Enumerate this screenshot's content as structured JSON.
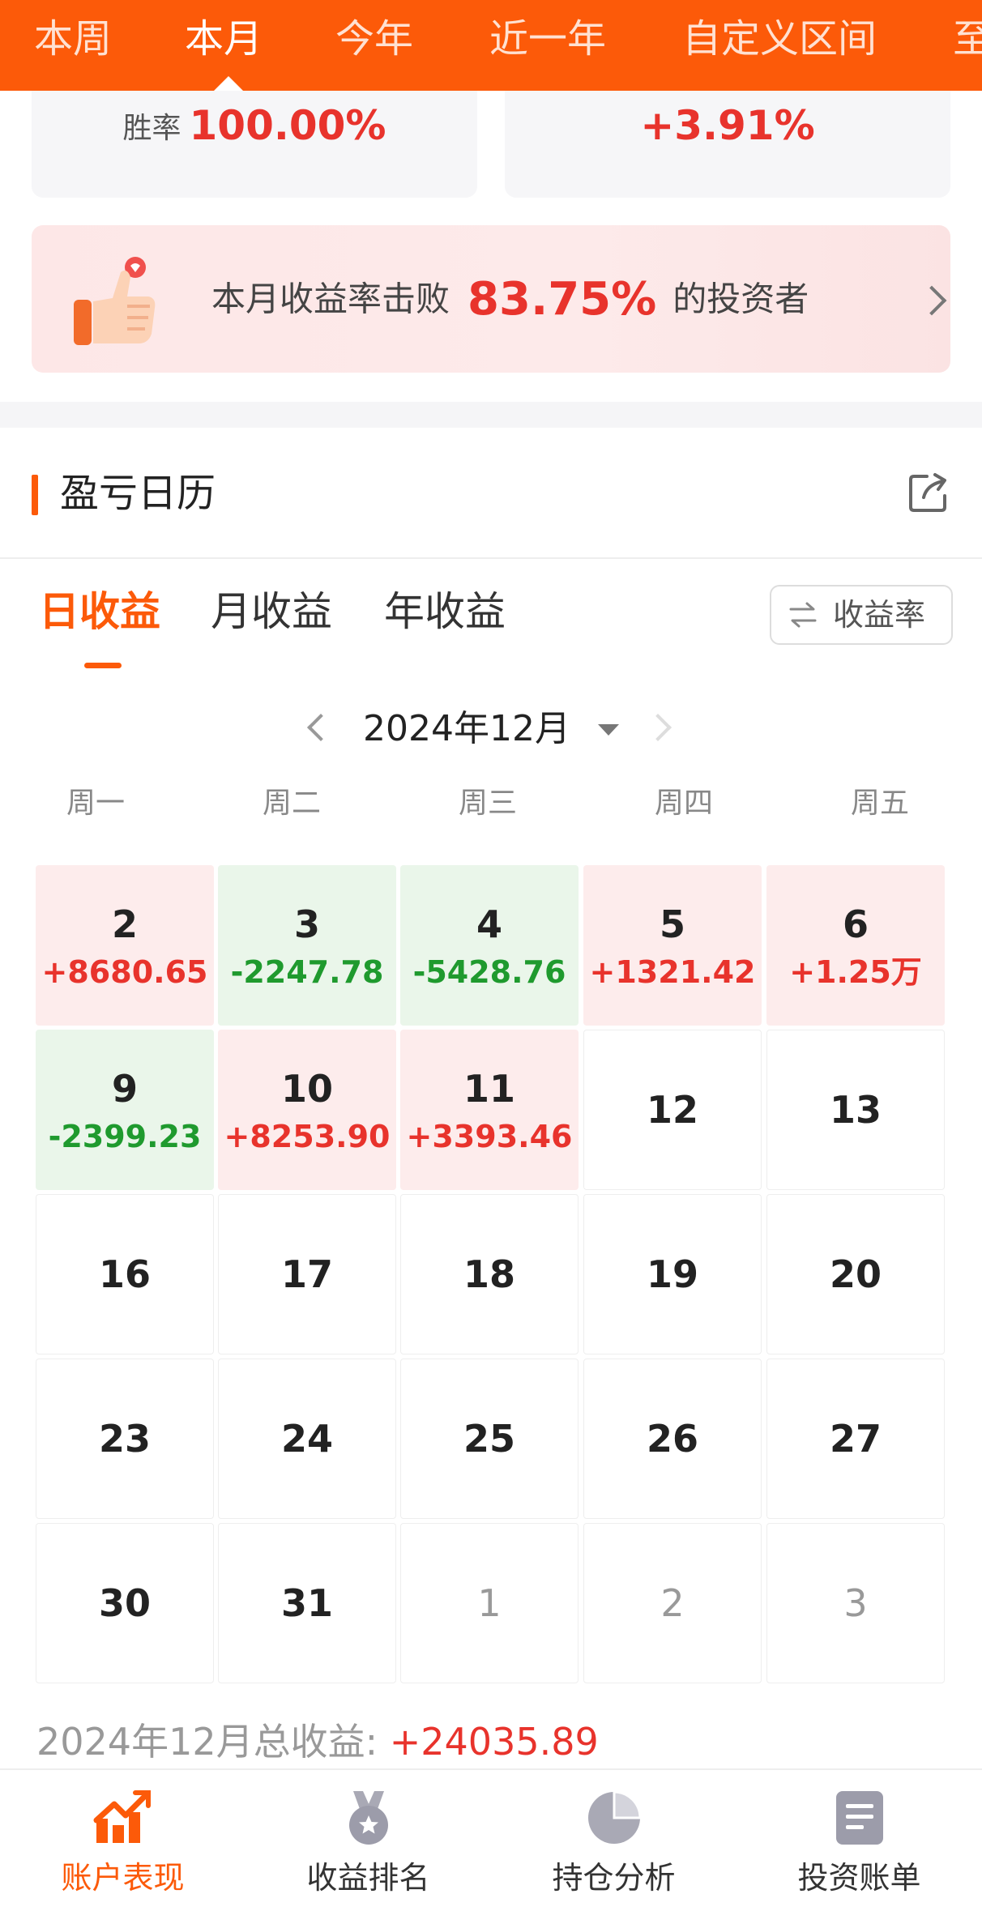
{
  "period_tabs": [
    {
      "label": "本周",
      "active": false
    },
    {
      "label": "本月",
      "active": true
    },
    {
      "label": "今年",
      "active": false
    },
    {
      "label": "近一年",
      "active": false
    },
    {
      "label": "自定义区间",
      "active": false
    },
    {
      "label": "至",
      "active": false
    }
  ],
  "summary": {
    "win_rate_label": "胜率",
    "win_rate_value": "100.00%",
    "return_value": "+3.91%"
  },
  "beat_banner": {
    "prefix": "本月收益率击败",
    "percent": "83.75%",
    "suffix": "的投资者"
  },
  "calendar": {
    "title": "盈亏日历",
    "tabs": [
      "日收益",
      "月收益",
      "年收益"
    ],
    "active_tab": "日收益",
    "rate_toggle_label": "收益率",
    "month_label": "2024年12月",
    "weekdays": [
      "周一",
      "周二",
      "周三",
      "周四",
      "周五"
    ],
    "days": [
      {
        "day": "2",
        "pl": "+8680.65",
        "type": "pos"
      },
      {
        "day": "3",
        "pl": "-2247.78",
        "type": "neg"
      },
      {
        "day": "4",
        "pl": "-5428.76",
        "type": "neg"
      },
      {
        "day": "5",
        "pl": "+1321.42",
        "type": "pos"
      },
      {
        "day": "6",
        "pl": "+1.25万",
        "type": "pos"
      },
      {
        "day": "9",
        "pl": "-2399.23",
        "type": "neg"
      },
      {
        "day": "10",
        "pl": "+8253.90",
        "type": "pos"
      },
      {
        "day": "11",
        "pl": "+3393.46",
        "type": "pos"
      },
      {
        "day": "12",
        "pl": "",
        "type": "none"
      },
      {
        "day": "13",
        "pl": "",
        "type": "none"
      },
      {
        "day": "16",
        "pl": "",
        "type": "none"
      },
      {
        "day": "17",
        "pl": "",
        "type": "none"
      },
      {
        "day": "18",
        "pl": "",
        "type": "none"
      },
      {
        "day": "19",
        "pl": "",
        "type": "none"
      },
      {
        "day": "20",
        "pl": "",
        "type": "none"
      },
      {
        "day": "23",
        "pl": "",
        "type": "none"
      },
      {
        "day": "24",
        "pl": "",
        "type": "none"
      },
      {
        "day": "25",
        "pl": "",
        "type": "none"
      },
      {
        "day": "26",
        "pl": "",
        "type": "none"
      },
      {
        "day": "27",
        "pl": "",
        "type": "none"
      },
      {
        "day": "30",
        "pl": "",
        "type": "none"
      },
      {
        "day": "31",
        "pl": "",
        "type": "none"
      },
      {
        "day": "1",
        "pl": "",
        "type": "other"
      },
      {
        "day": "2",
        "pl": "",
        "type": "other"
      },
      {
        "day": "3",
        "pl": "",
        "type": "other"
      }
    ],
    "total_label": "2024年12月总收益: ",
    "total_value": "+24035.89"
  },
  "bottom_nav": [
    {
      "label": "账户表现",
      "icon": "trend-chart-icon",
      "active": true
    },
    {
      "label": "收益排名",
      "icon": "medal-icon",
      "active": false
    },
    {
      "label": "持仓分析",
      "icon": "pie-chart-icon",
      "active": false
    },
    {
      "label": "投资账单",
      "icon": "bill-icon",
      "active": false
    }
  ],
  "colors": {
    "brand": "#fc5a09",
    "profit": "#e8332c",
    "loss": "#1f9a2e",
    "profit_bg": "#fdecec",
    "loss_bg": "#eaf6ea"
  }
}
